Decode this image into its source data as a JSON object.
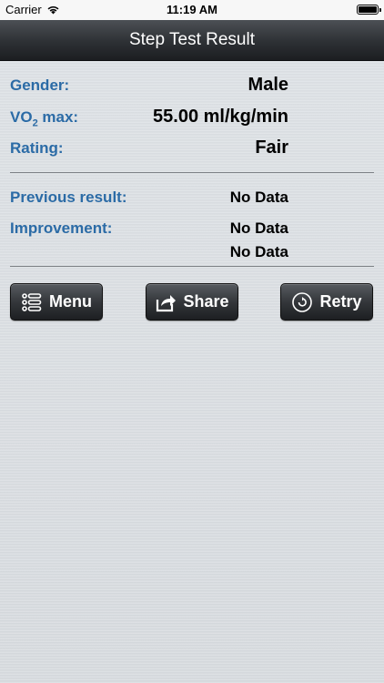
{
  "status_bar": {
    "carrier": "Carrier",
    "time": "11:19 AM",
    "icons": [
      "wifi-icon",
      "battery-icon"
    ]
  },
  "nav": {
    "title": "Step Test Result"
  },
  "result": {
    "gender_label": "Gender:",
    "gender_value": "Male",
    "vo2_label_prefix": "VO",
    "vo2_label_sub": "2",
    "vo2_label_suffix": " max:",
    "vo2_value": "55.00 ml/kg/min",
    "rating_label": "Rating:",
    "rating_value": "Fair"
  },
  "history": {
    "previous_label": "Previous result:",
    "previous_value": "No Data",
    "improvement_label": "Improvement:",
    "improvement_value_1": "No Data",
    "improvement_value_2": "No Data"
  },
  "buttons": {
    "menu": {
      "label": "Menu",
      "icon": "list-icon"
    },
    "share": {
      "label": "Share",
      "icon": "share-icon"
    },
    "retry": {
      "label": "Retry",
      "icon": "retry-icon"
    }
  },
  "colors": {
    "label_blue": "#2b6ba6",
    "nav_dark": "#2d3034",
    "background": "#d9dde1"
  }
}
